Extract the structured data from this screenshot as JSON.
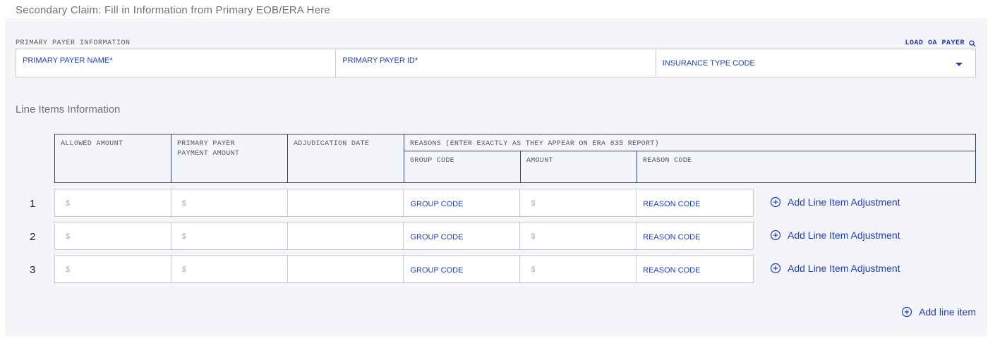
{
  "heading": "Secondary Claim: Fill in Information from Primary EOB/ERA Here",
  "primary_payer": {
    "section_label": "PRIMARY PAYER INFORMATION",
    "load_link": "LOAD OA PAYER",
    "name_label": "PRIMARY PAYER NAME*",
    "id_label": "PRIMARY PAYER ID*",
    "insurance_type_label": "INSURANCE TYPE CODE"
  },
  "line_items": {
    "title": "Line Items Information",
    "headers": {
      "allowed_amount": "ALLOWED AMOUNT",
      "primary_payment_line1": "PRIMARY PAYER",
      "primary_payment_line2": "PAYMENT AMOUNT",
      "adjudication_date": "ADJUDICATION DATE",
      "reasons": "REASONS (ENTER EXACTLY AS THEY APPEAR ON ERA 835 REPORT)",
      "group_code": "GROUP CODE",
      "amount": "AMOUNT",
      "reason_code": "REASON CODE"
    },
    "rows": [
      {
        "num": "1",
        "allowed": "$",
        "payment": "$",
        "group_code": "GROUP CODE",
        "amount": "$",
        "reason_code": "REASON CODE",
        "adjust_label": "Add Line Item Adjustment"
      },
      {
        "num": "2",
        "allowed": "$",
        "payment": "$",
        "group_code": "GROUP CODE",
        "amount": "$",
        "reason_code": "REASON CODE",
        "adjust_label": "Add Line Item Adjustment"
      },
      {
        "num": "3",
        "allowed": "$",
        "payment": "$",
        "group_code": "GROUP CODE",
        "amount": "$",
        "reason_code": "REASON CODE",
        "adjust_label": "Add Line Item Adjustment"
      }
    ],
    "add_line_item": "Add line item"
  },
  "colors": {
    "accent": "#1e3bc8",
    "panel": "#f3f5f9",
    "border": "#c6c9d1"
  }
}
